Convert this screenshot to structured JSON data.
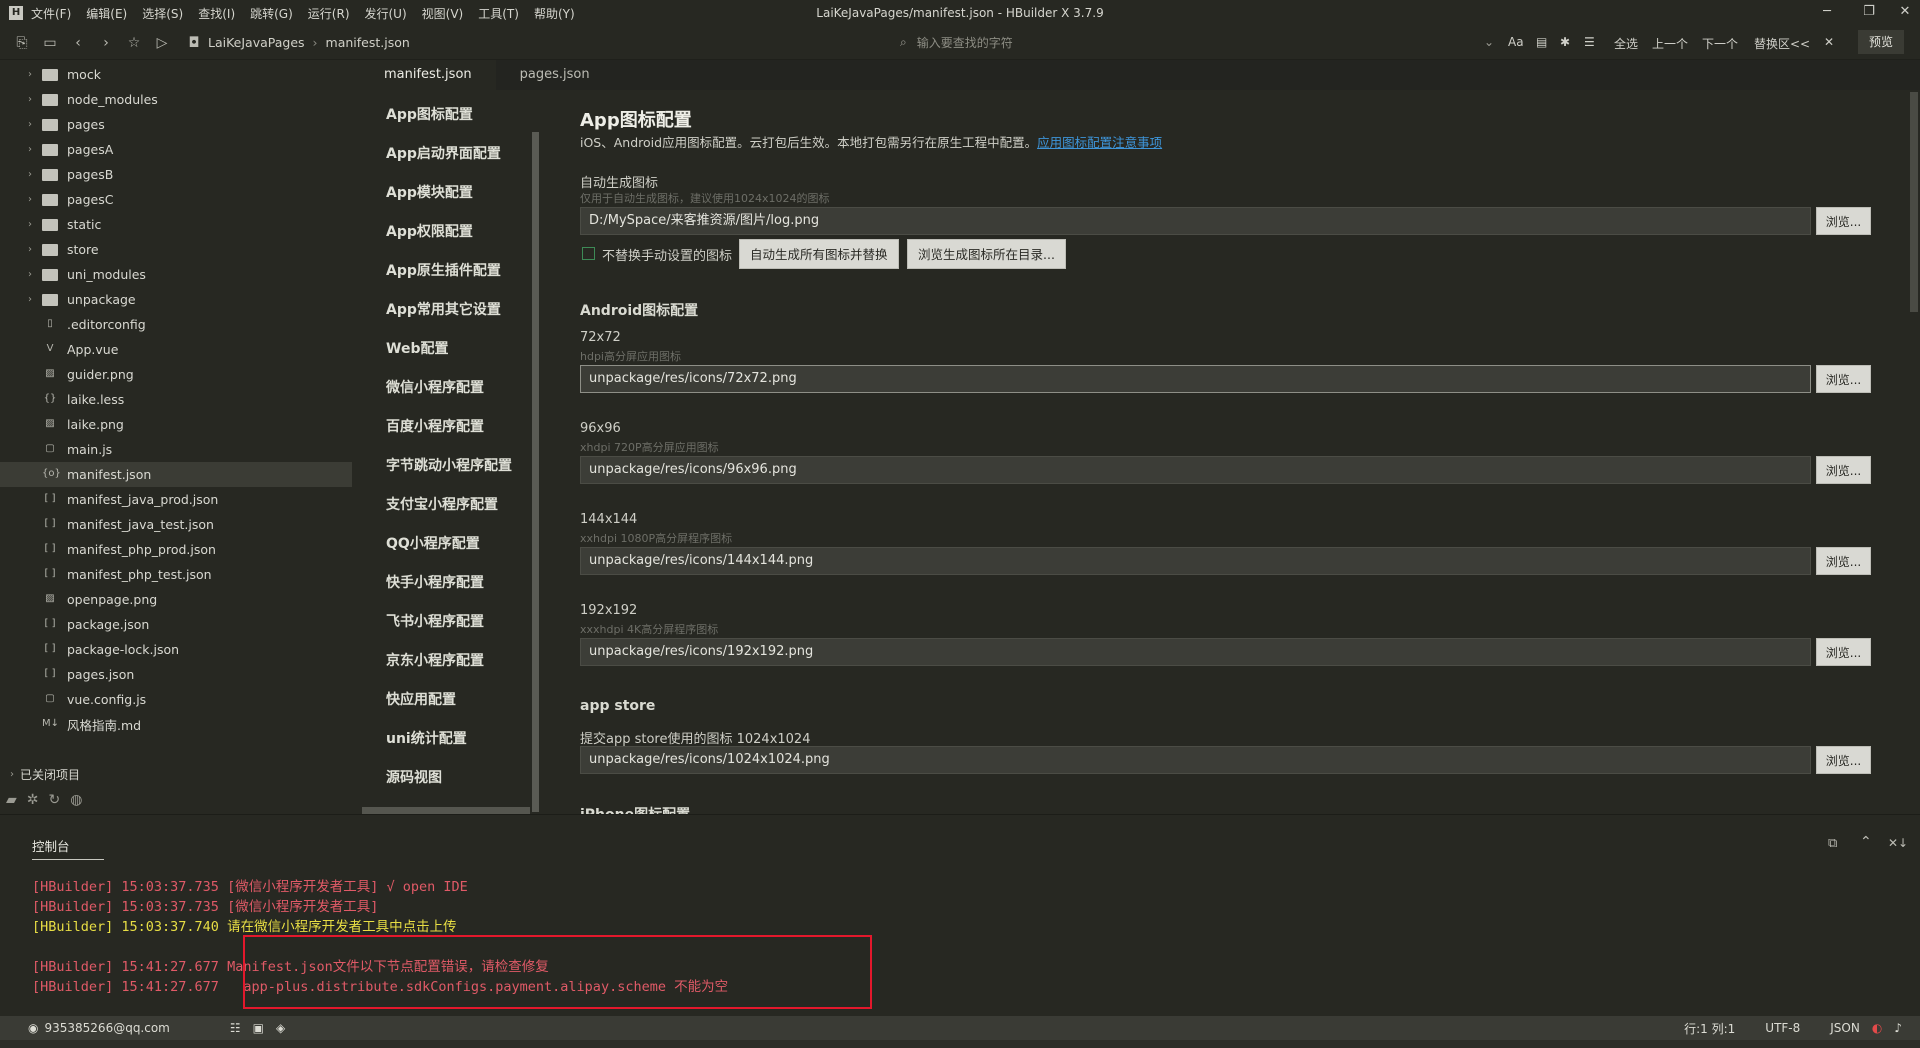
{
  "window": {
    "title": "LaiKeJavaPages/manifest.json - HBuilder X 3.7.9",
    "menu": [
      "文件(F)",
      "编辑(E)",
      "选择(S)",
      "查找(I)",
      "跳转(G)",
      "运行(R)",
      "发行(U)",
      "视图(V)",
      "工具(T)",
      "帮助(Y)"
    ]
  },
  "toolbar": {
    "breadcrumb": [
      "LaiKeJavaPages",
      "manifest.json"
    ],
    "search_placeholder": "输入要查找的字符",
    "find_buttons": [
      "全选",
      "上一个",
      "下一个",
      "替换区<<"
    ],
    "preview": "预览"
  },
  "sidebar": {
    "items": [
      {
        "label": "mock",
        "type": "folder"
      },
      {
        "label": "node_modules",
        "type": "folder"
      },
      {
        "label": "pages",
        "type": "folder"
      },
      {
        "label": "pagesA",
        "type": "folder"
      },
      {
        "label": "pagesB",
        "type": "folder"
      },
      {
        "label": "pagesC",
        "type": "folder"
      },
      {
        "label": "static",
        "type": "folder"
      },
      {
        "label": "store",
        "type": "folder"
      },
      {
        "label": "uni_modules",
        "type": "folder"
      },
      {
        "label": "unpackage",
        "type": "folder"
      },
      {
        "label": ".editorconfig",
        "type": "file",
        "icon": "page-icon"
      },
      {
        "label": "App.vue",
        "type": "file",
        "icon": "vue-icon"
      },
      {
        "label": "guider.png",
        "type": "file",
        "icon": "image-icon"
      },
      {
        "label": "laike.less",
        "type": "file",
        "icon": "braces-icon"
      },
      {
        "label": "laike.png",
        "type": "file",
        "icon": "image-icon"
      },
      {
        "label": "main.js",
        "type": "file",
        "icon": "js-icon"
      },
      {
        "label": "manifest.json",
        "type": "file",
        "icon": "json-icon",
        "active": true
      },
      {
        "label": "manifest_java_prod.json",
        "type": "file",
        "icon": "brackets-icon"
      },
      {
        "label": "manifest_java_test.json",
        "type": "file",
        "icon": "brackets-icon"
      },
      {
        "label": "manifest_php_prod.json",
        "type": "file",
        "icon": "brackets-icon"
      },
      {
        "label": "manifest_php_test.json",
        "type": "file",
        "icon": "brackets-icon"
      },
      {
        "label": "openpage.png",
        "type": "file",
        "icon": "image-icon"
      },
      {
        "label": "package.json",
        "type": "file",
        "icon": "brackets-icon"
      },
      {
        "label": "package-lock.json",
        "type": "file",
        "icon": "brackets-icon"
      },
      {
        "label": "pages.json",
        "type": "file",
        "icon": "brackets-icon"
      },
      {
        "label": "vue.config.js",
        "type": "file",
        "icon": "js-icon"
      },
      {
        "label": "风格指南.md",
        "type": "file",
        "icon": "markdown-icon"
      }
    ],
    "closed_projects": "已关闭项目"
  },
  "tabs": [
    "manifest.json",
    "pages.json"
  ],
  "nav": [
    "App图标配置",
    "App启动界面配置",
    "App模块配置",
    "App权限配置",
    "App原生插件配置",
    "App常用其它设置",
    "Web配置",
    "微信小程序配置",
    "百度小程序配置",
    "字节跳动小程序配置",
    "支付宝小程序配置",
    "QQ小程序配置",
    "快手小程序配置",
    "飞书小程序配置",
    "京东小程序配置",
    "快应用配置",
    "uni统计配置",
    "源码视图"
  ],
  "main": {
    "title": "App图标配置",
    "desc": "iOS、Android应用图标配置。云打包后生效。本地打包需另行在原生工程中配置。",
    "desc_link": "应用图标配置注意事项",
    "auto": {
      "label": "自动生成图标",
      "hint": "仅用于自动生成图标，建议使用1024x1024的图标",
      "value": "D:/MySpace/来客推资源/图片/log.png",
      "checkbox": "不替换手动设置的图标",
      "btn1": "自动生成所有图标并替换",
      "btn2": "浏览生成图标所在目录..."
    },
    "android_title": "Android图标配置",
    "icons": [
      {
        "size": "72x72",
        "hint": "hdpi高分屏应用图标",
        "value": "unpackage/res/icons/72x72.png"
      },
      {
        "size": "96x96",
        "hint": "xhdpi 720P高分屏应用图标",
        "value": "unpackage/res/icons/96x96.png"
      },
      {
        "size": "144x144",
        "hint": "xxhdpi 1080P高分屏程序图标",
        "value": "unpackage/res/icons/144x144.png"
      },
      {
        "size": "192x192",
        "hint": "xxxhdpi 4K高分屏程序图标",
        "value": "unpackage/res/icons/192x192.png"
      }
    ],
    "appstore_title": "app store",
    "appstore": {
      "label": "提交app store使用的图标 1024x1024",
      "value": "unpackage/res/icons/1024x1024.png"
    },
    "iphone_title": "iPhone图标配置",
    "browse": "浏览..."
  },
  "console": {
    "tab": "控制台",
    "lines": [
      {
        "text": "[HBuilder] 15:03:37.735 [微信小程序开发者工具] √ open IDE",
        "color": "#e05a67"
      },
      {
        "text": "[HBuilder] 15:03:37.735 [微信小程序开发者工具]",
        "color": "#e05a67"
      },
      {
        "text": "[HBuilder] 15:03:37.740 请在微信小程序开发者工具中点击上传",
        "color": "#e8de44"
      },
      {
        "text": "[HBuilder] 15:41:27.677 Manifest.json文件以下节点配置错误，请检查修复",
        "color": "#e05a67"
      },
      {
        "text": "[HBuilder] 15:41:27.677   app-plus.distribute.sdkConfigs.payment.alipay.scheme 不能为空",
        "color": "#e05a67"
      }
    ]
  },
  "status": {
    "user": "935385266@qq.com",
    "position": "行:1  列:1",
    "encoding": "UTF-8",
    "lang": "JSON"
  }
}
